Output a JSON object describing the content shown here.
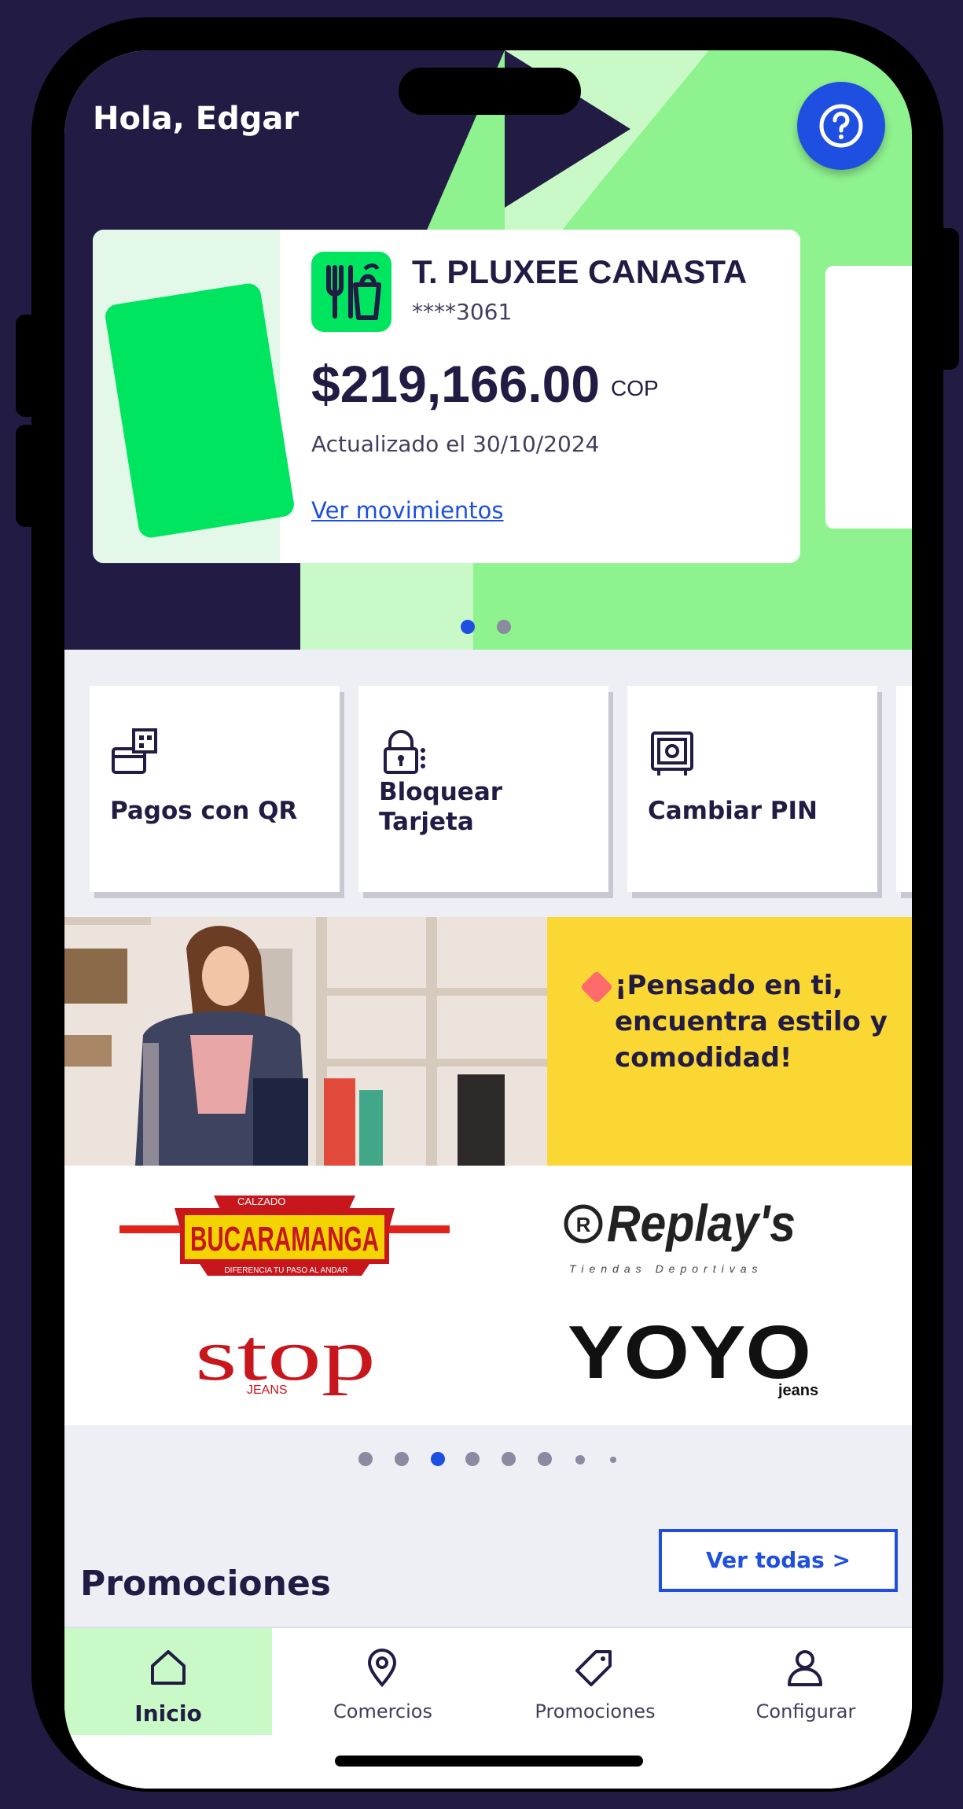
{
  "header": {
    "greeting": "Hola, Edgar",
    "help_icon": "question-circle-icon"
  },
  "card": {
    "title": "T. PLUXEE CANASTA",
    "number": "****3061",
    "amount": "$219,166.00",
    "currency": "COP",
    "updated": "Actualizado el 30/10/2024",
    "link": "Ver movimientos",
    "icon": "food-basket-icon"
  },
  "card_carousel": {
    "count": 2,
    "active": 0
  },
  "quick_actions": [
    {
      "label": "Pagos con QR",
      "icon": "qr-pay-icon"
    },
    {
      "label": "Bloquear Tarjeta",
      "icon": "lock-icon"
    },
    {
      "label": "Cambiar PIN",
      "icon": "safe-icon"
    }
  ],
  "banner": {
    "text": "¡Pensado en ti, encuentra estilo y comodidad!",
    "brands": [
      "BUCARAMANGA",
      "Replay's",
      "stop",
      "YOYO"
    ],
    "brand_subtexts": {
      "bucaramanga_top": "CALZADO",
      "bucaramanga_bottom": "DIFERENCIA TU PASO AL ANDAR",
      "replays_sub": "Tiendas Deportivas",
      "stop_sub": "JEANS",
      "yoyo_sub": "jeans"
    }
  },
  "banner_carousel": {
    "count": 8,
    "active": 2
  },
  "promotions": {
    "title": "Promociones",
    "button": "Ver todas >"
  },
  "tabbar": [
    {
      "label": "Inicio",
      "icon": "home-icon",
      "active": true
    },
    {
      "label": "Comercios",
      "icon": "map-pin-icon",
      "active": false
    },
    {
      "label": "Promociones",
      "icon": "tag-icon",
      "active": false
    },
    {
      "label": "Configurar",
      "icon": "user-icon",
      "active": false
    }
  ],
  "colors": {
    "navy": "#221c44",
    "green": "#00e560",
    "light_green": "#8ef28f",
    "blue": "#1f4fe0",
    "yellow": "#fbd734"
  }
}
